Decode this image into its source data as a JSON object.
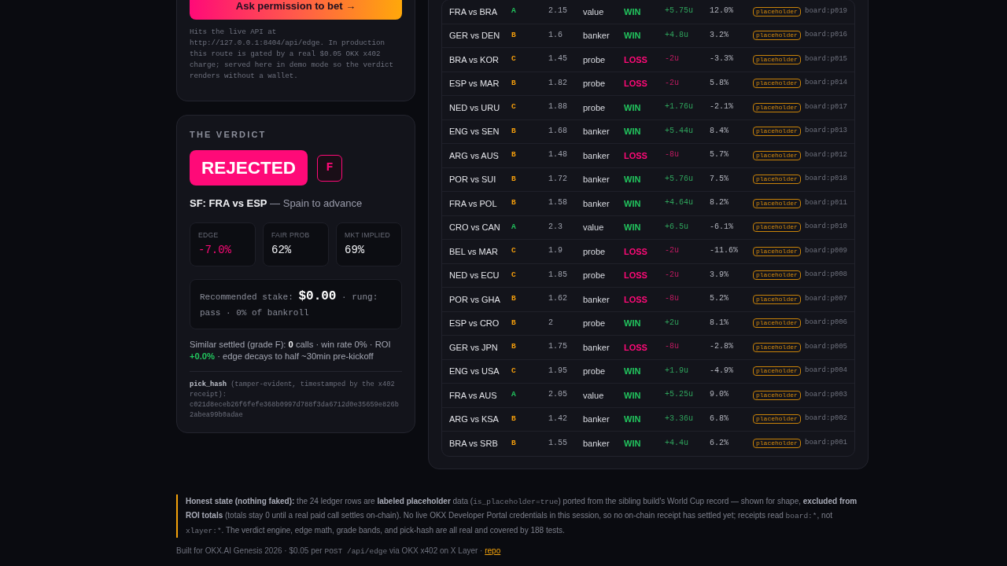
{
  "request_card": {
    "button": "Ask permission to bet →",
    "note": "Hits the live API at http://127.0.0.1:8404/api/edge. In production this route is gated by a real $0.05 OKX x402 charge; served here in demo mode so the verdict renders without a wallet."
  },
  "verdict": {
    "heading": "THE VERDICT",
    "status": {
      "label": "REJECTED",
      "kind": "rejected"
    },
    "grade": "F",
    "match": "**SF: FRA vs ESP** — Spain to advance",
    "stats": [
      {
        "label": "EDGE",
        "value": "-7.0%",
        "kind": "negative"
      },
      {
        "label": "FAIR PROB",
        "value": "62%",
        "kind": "neutral"
      },
      {
        "label": "MKT IMPLIED",
        "value": "69%",
        "kind": "neutral"
      }
    ],
    "stake": "Recommended stake: **$0.00** · rung: pass · 0% of bankroll",
    "similar": [
      {
        "kind": "plain",
        "text": "Similar settled (grade F): "
      },
      {
        "kind": "strong",
        "text": "0"
      },
      {
        "kind": "plain",
        "text": " calls · win rate 0% · ROI "
      },
      {
        "kind": "positive",
        "text": "+0.0%"
      },
      {
        "kind": "plain",
        "text": " · edge decays to half ~30min pre-kickoff"
      }
    ],
    "pick_hash": {
      "label": "**pick_hash** (tamper-evident, timestamped by the x402 receipt):",
      "value": "c021d8eceb26f6fefe368b0997d788f3da6712d0e35659e826b2abea99b0adae"
    }
  },
  "ledger": {
    "rows": [
      {
        "column_1": "FRA vs BRA",
        "column_2": {
          "text": "A",
          "color": "#22c55e"
        },
        "column_3": "2.15",
        "column_4": "value",
        "column_5": {
          "text": "WIN",
          "kind": "win"
        },
        "column_6": "+5.75u",
        "column_7": "12.0%",
        "column_8": "placeholder",
        "column_9": "board:p019"
      },
      {
        "column_1": "GER vs DEN",
        "column_2": {
          "text": "B",
          "color": "#f59e0b"
        },
        "column_3": "1.6",
        "column_4": "banker",
        "column_5": {
          "text": "WIN",
          "kind": "win"
        },
        "column_6": "+4.8u",
        "column_7": "3.2%",
        "column_8": "placeholder",
        "column_9": "board:p016"
      },
      {
        "column_1": "BRA vs KOR",
        "column_2": {
          "text": "C",
          "color": "#f59e0b"
        },
        "column_3": "1.45",
        "column_4": "probe",
        "column_5": {
          "text": "LOSS",
          "kind": "loss"
        },
        "column_6": "-2u",
        "column_7": "-3.3%",
        "column_8": "placeholder",
        "column_9": "board:p015"
      },
      {
        "column_1": "ESP vs MAR",
        "column_2": {
          "text": "B",
          "color": "#f59e0b"
        },
        "column_3": "1.82",
        "column_4": "probe",
        "column_5": {
          "text": "LOSS",
          "kind": "loss"
        },
        "column_6": "-2u",
        "column_7": "5.8%",
        "column_8": "placeholder",
        "column_9": "board:p014"
      },
      {
        "column_1": "NED vs URU",
        "column_2": {
          "text": "C",
          "color": "#f59e0b"
        },
        "column_3": "1.88",
        "column_4": "probe",
        "column_5": {
          "text": "WIN",
          "kind": "win"
        },
        "column_6": "+1.76u",
        "column_7": "-2.1%",
        "column_8": "placeholder",
        "column_9": "board:p017"
      },
      {
        "column_1": "ENG vs SEN",
        "column_2": {
          "text": "B",
          "color": "#f59e0b"
        },
        "column_3": "1.68",
        "column_4": "banker",
        "column_5": {
          "text": "WIN",
          "kind": "win"
        },
        "column_6": "+5.44u",
        "column_7": "8.4%",
        "column_8": "placeholder",
        "column_9": "board:p013"
      },
      {
        "column_1": "ARG vs AUS",
        "column_2": {
          "text": "B",
          "color": "#f59e0b"
        },
        "column_3": "1.48",
        "column_4": "banker",
        "column_5": {
          "text": "LOSS",
          "kind": "loss"
        },
        "column_6": "-8u",
        "column_7": "5.7%",
        "column_8": "placeholder",
        "column_9": "board:p012"
      },
      {
        "column_1": "POR vs SUI",
        "column_2": {
          "text": "B",
          "color": "#f59e0b"
        },
        "column_3": "1.72",
        "column_4": "banker",
        "column_5": {
          "text": "WIN",
          "kind": "win"
        },
        "column_6": "+5.76u",
        "column_7": "7.5%",
        "column_8": "placeholder",
        "column_9": "board:p018"
      },
      {
        "column_1": "FRA vs POL",
        "column_2": {
          "text": "B",
          "color": "#f59e0b"
        },
        "column_3": "1.58",
        "column_4": "banker",
        "column_5": {
          "text": "WIN",
          "kind": "win"
        },
        "column_6": "+4.64u",
        "column_7": "8.2%",
        "column_8": "placeholder",
        "column_9": "board:p011"
      },
      {
        "column_1": "CRO vs CAN",
        "column_2": {
          "text": "A",
          "color": "#22c55e"
        },
        "column_3": "2.3",
        "column_4": "value",
        "column_5": {
          "text": "WIN",
          "kind": "win"
        },
        "column_6": "+6.5u",
        "column_7": "-6.1%",
        "column_8": "placeholder",
        "column_9": "board:p010"
      },
      {
        "column_1": "BEL vs MAR",
        "column_2": {
          "text": "C",
          "color": "#f59e0b"
        },
        "column_3": "1.9",
        "column_4": "probe",
        "column_5": {
          "text": "LOSS",
          "kind": "loss"
        },
        "column_6": "-2u",
        "column_7": "-11.6%",
        "column_8": "placeholder",
        "column_9": "board:p009"
      },
      {
        "column_1": "NED vs ECU",
        "column_2": {
          "text": "C",
          "color": "#f59e0b"
        },
        "column_3": "1.85",
        "column_4": "probe",
        "column_5": {
          "text": "LOSS",
          "kind": "loss"
        },
        "column_6": "-2u",
        "column_7": "3.9%",
        "column_8": "placeholder",
        "column_9": "board:p008"
      },
      {
        "column_1": "POR vs GHA",
        "column_2": {
          "text": "B",
          "color": "#f59e0b"
        },
        "column_3": "1.62",
        "column_4": "banker",
        "column_5": {
          "text": "LOSS",
          "kind": "loss"
        },
        "column_6": "-8u",
        "column_7": "5.2%",
        "column_8": "placeholder",
        "column_9": "board:p007"
      },
      {
        "column_1": "ESP vs CRO",
        "column_2": {
          "text": "B",
          "color": "#f59e0b"
        },
        "column_3": "2",
        "column_4": "probe",
        "column_5": {
          "text": "WIN",
          "kind": "win"
        },
        "column_6": "+2u",
        "column_7": "8.1%",
        "column_8": "placeholder",
        "column_9": "board:p006"
      },
      {
        "column_1": "GER vs JPN",
        "column_2": {
          "text": "B",
          "color": "#f59e0b"
        },
        "column_3": "1.75",
        "column_4": "banker",
        "column_5": {
          "text": "LOSS",
          "kind": "loss"
        },
        "column_6": "-8u",
        "column_7": "-2.8%",
        "column_8": "placeholder",
        "column_9": "board:p005"
      },
      {
        "column_1": "ENG vs USA",
        "column_2": {
          "text": "C",
          "color": "#f59e0b"
        },
        "column_3": "1.95",
        "column_4": "probe",
        "column_5": {
          "text": "WIN",
          "kind": "win"
        },
        "column_6": "+1.9u",
        "column_7": "-4.9%",
        "column_8": "placeholder",
        "column_9": "board:p004"
      },
      {
        "column_1": "FRA vs AUS",
        "column_2": {
          "text": "A",
          "color": "#22c55e"
        },
        "column_3": "2.05",
        "column_4": "value",
        "column_5": {
          "text": "WIN",
          "kind": "win"
        },
        "column_6": "+5.25u",
        "column_7": "9.0%",
        "column_8": "placeholder",
        "column_9": "board:p003"
      },
      {
        "column_1": "ARG vs KSA",
        "column_2": {
          "text": "B",
          "color": "#f59e0b"
        },
        "column_3": "1.42",
        "column_4": "banker",
        "column_5": {
          "text": "WIN",
          "kind": "win"
        },
        "column_6": "+3.36u",
        "column_7": "6.8%",
        "column_8": "placeholder",
        "column_9": "board:p002"
      },
      {
        "column_1": "BRA vs SRB",
        "column_2": {
          "text": "B",
          "color": "#f59e0b"
        },
        "column_3": "1.55",
        "column_4": "banker",
        "column_5": {
          "text": "WIN",
          "kind": "win"
        },
        "column_6": "+4.4u",
        "column_7": "6.2%",
        "column_8": "placeholder",
        "column_9": "board:p001"
      }
    ]
  },
  "footer": {
    "note": [
      {
        "kind": "text",
        "text": "**Honest state (nothing faked):** the 24 ledger rows are **labeled placeholder** data ("
      },
      {
        "kind": "code",
        "text": "is_placeholder=true"
      },
      {
        "kind": "text",
        "text": ") ported from the sibling build's World Cup record — shown for shape, **excluded from ROI totals** (totals stay 0 until a real paid call settles on-chain). No live OKX Developer Portal credentials in this session, so no on-chain receipt has settled yet; receipts read "
      },
      {
        "kind": "code",
        "text": "board:*"
      },
      {
        "kind": "text",
        "text": ", not "
      },
      {
        "kind": "code",
        "text": "xlayer:*"
      },
      {
        "kind": "text",
        "text": ". The verdict engine, edge math, grade bands, and pick-hash are all real and covered by 188 tests."
      }
    ],
    "credit": [
      {
        "kind": "text",
        "text": "Built for OKX.AI Genesis 2026 · $0.05 per "
      },
      {
        "kind": "code",
        "text": "POST /api/edge"
      },
      {
        "kind": "text",
        "text": " via OKX x402 on X Layer · "
      },
      {
        "kind": "link",
        "text": "repo"
      }
    ]
  }
}
